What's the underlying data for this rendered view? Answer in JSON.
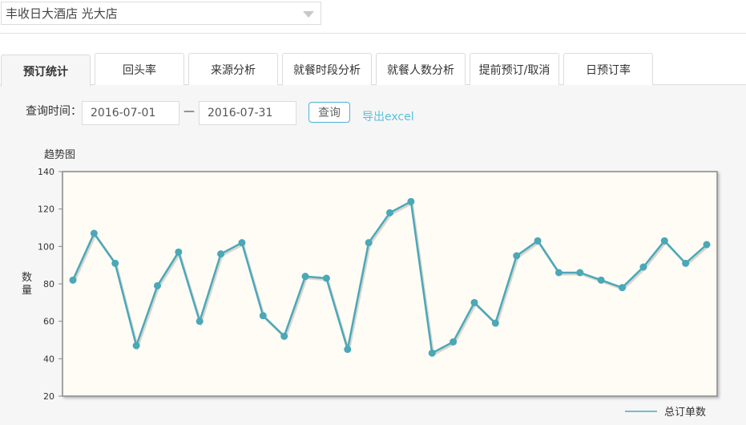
{
  "store_select": {
    "value": "丰收日大酒店 光大店"
  },
  "tabs": [
    {
      "label": "预订统计"
    },
    {
      "label": "回头率"
    },
    {
      "label": "来源分析"
    },
    {
      "label": "就餐时段分析"
    },
    {
      "label": "就餐人数分析"
    },
    {
      "label": "提前预订/取消"
    },
    {
      "label": "日预订率"
    }
  ],
  "query": {
    "label": "查询时间：",
    "start_date": "2016-07-01",
    "separator": "—",
    "end_date": "2016-07-31",
    "button_label": "查询",
    "export_label": "导出excel"
  },
  "chart_data": {
    "type": "line",
    "title": "趋势图",
    "ylabel": "数量",
    "ylim": [
      20,
      140
    ],
    "yticks": [
      20,
      40,
      60,
      80,
      100,
      120,
      140
    ],
    "grid": false,
    "legend_position": "bottom-right",
    "series": [
      {
        "name": "总订单数",
        "color": "#4aa8b8",
        "values": [
          82,
          107,
          91,
          47,
          79,
          97,
          60,
          96,
          102,
          63,
          52,
          84,
          83,
          45,
          102,
          118,
          124,
          43,
          49,
          70,
          59,
          95,
          103,
          86,
          86,
          82,
          78,
          89,
          103,
          91,
          101
        ]
      }
    ],
    "plot_background": "#fffcf5"
  }
}
